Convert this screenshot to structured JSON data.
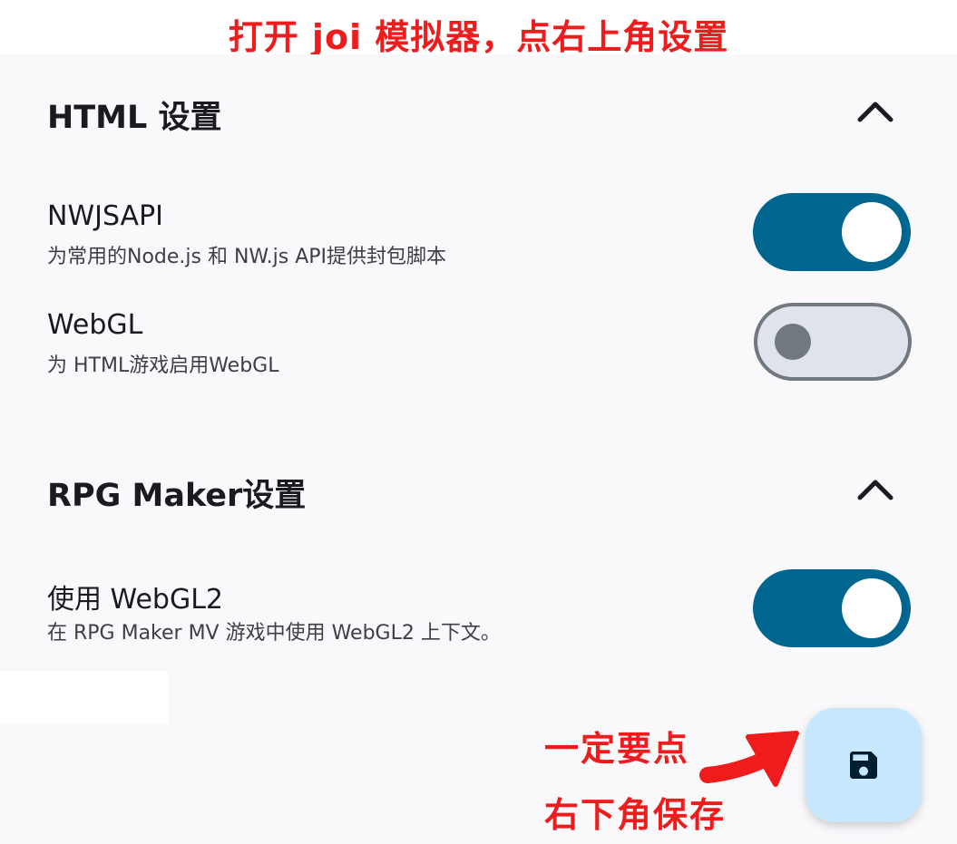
{
  "annotations": {
    "top": "打开 joi 模拟器，点右上角设置",
    "note_line1": "一定要点",
    "note_line2": "右下角保存"
  },
  "sections": {
    "html": {
      "title": "HTML 设置",
      "expanded": true,
      "items": [
        {
          "title": "NWJSAPI",
          "subtitle": "为常用的Node.js 和 NW.js API提供封包脚本",
          "enabled": true
        },
        {
          "title": "WebGL",
          "subtitle": "为 HTML游戏启用WebGL",
          "enabled": false
        }
      ]
    },
    "rpg": {
      "title": "RPG Maker设置",
      "expanded": true,
      "items": [
        {
          "title": "使用 WebGL2",
          "subtitle": "在 RPG Maker MV 游戏中使用 WebGL2 上下文。",
          "enabled": true
        }
      ]
    }
  },
  "icons": {
    "collapse": "chevron-up-icon",
    "save": "save-icon",
    "pointer": "arrow-icon"
  },
  "colors": {
    "accent": "#00658f",
    "fab_bg": "#c7e7ff",
    "annotation": "#ee1c1c"
  }
}
